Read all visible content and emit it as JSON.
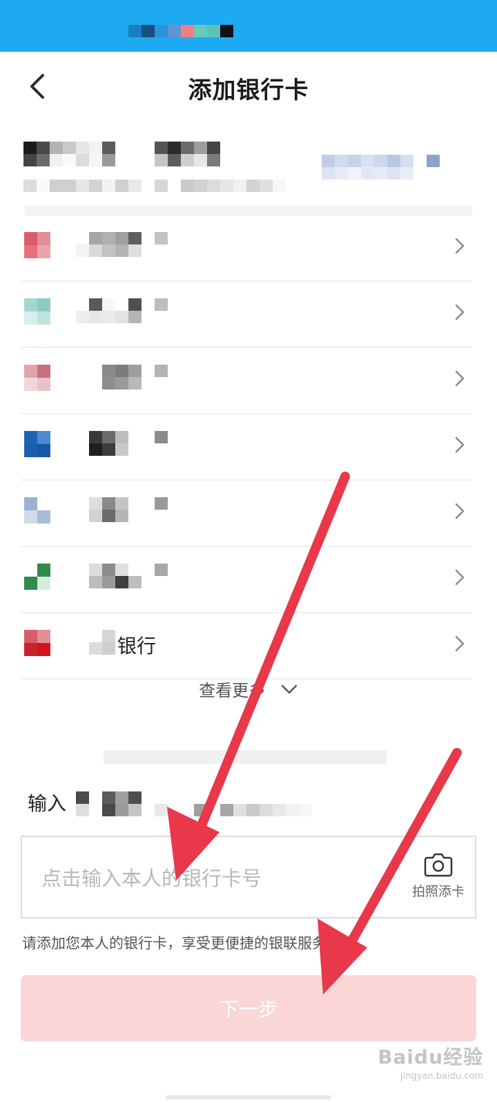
{
  "page": {
    "title": "添加银行卡"
  },
  "banks": [
    {
      "name": "",
      "logo_colors": [
        "#d95c68",
        "#e28e96",
        "#e8727c",
        "#e8a4aa"
      ]
    },
    {
      "name": "",
      "logo_colors": [
        "#a3d6cf",
        "#8ccbc2",
        "#d7efeb",
        "#bfe3de"
      ]
    },
    {
      "name": "",
      "logo_colors": [
        "#e0a4ad",
        "#c8707e",
        "#f0d6da",
        "#eac1c7"
      ]
    },
    {
      "name": "",
      "logo_colors": [
        "#1d63b5",
        "#4b8ad0",
        "#1c5fae",
        "#1a58a4"
      ]
    },
    {
      "name": "",
      "logo_colors": [
        "#9bb1d0",
        "#ffffff",
        "#cfdbea",
        "#a9bdd8"
      ]
    },
    {
      "name": "",
      "logo_colors": [
        "#ffffff",
        "#2f8a4c",
        "#2f8a4c",
        "#d8ebdf"
      ]
    },
    {
      "name": "银行",
      "logo_colors": [
        "#d95c68",
        "#e28e96",
        "#c8242f",
        "#d2141f"
      ]
    }
  ],
  "more": {
    "label": "查看更多"
  },
  "card_input": {
    "label": "输入",
    "placeholder": "点击输入本人的银行卡号",
    "camera_label": "拍照添卡"
  },
  "hint": "请添加您本人的银行卡，享受更便捷的银联服务",
  "next_button": "下一步",
  "watermark": {
    "main": "Baidu经验",
    "url": "jingyan.baidu.com"
  },
  "colors": {
    "status_bar": "#1eaaf1",
    "next_button_bg": "#fbd6d7",
    "arrow": "#e8384a"
  }
}
